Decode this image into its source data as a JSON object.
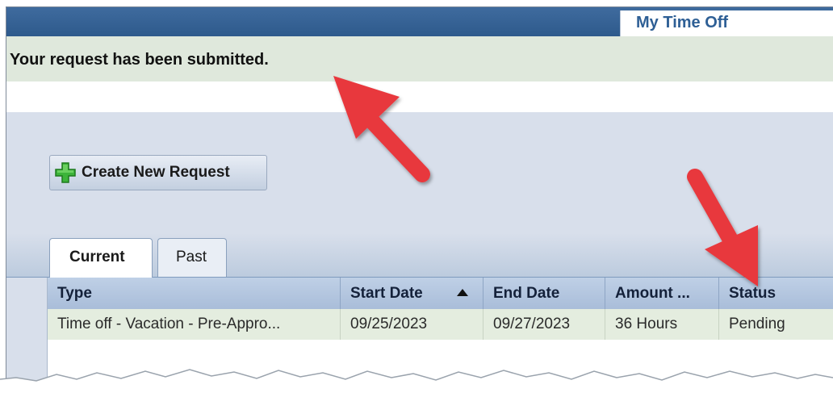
{
  "header": {
    "title": "My Time Off"
  },
  "notice": {
    "message": "Your request has been submitted."
  },
  "toolbar": {
    "create_label": "Create New Request",
    "create_icon": "plus-icon"
  },
  "tabs": [
    {
      "label": "Current",
      "active": true
    },
    {
      "label": "Past",
      "active": false
    }
  ],
  "table": {
    "columns": [
      "Type",
      "Start Date",
      "End Date",
      "Amount ...",
      "Status"
    ],
    "sort": {
      "column": "Start Date",
      "direction": "ascending"
    },
    "rows": [
      [
        "Time off - Vacation - Pre-Appro...",
        "09/25/2023",
        "09/27/2023",
        "36 Hours",
        "Pending"
      ]
    ]
  },
  "colors": {
    "header_bar": "#2e5a8c",
    "notice_bg": "#dfe8dc",
    "panel_bg": "#d8dfeb",
    "row_bg": "#e4eddf",
    "annotation_arrow": "#e8383d"
  }
}
